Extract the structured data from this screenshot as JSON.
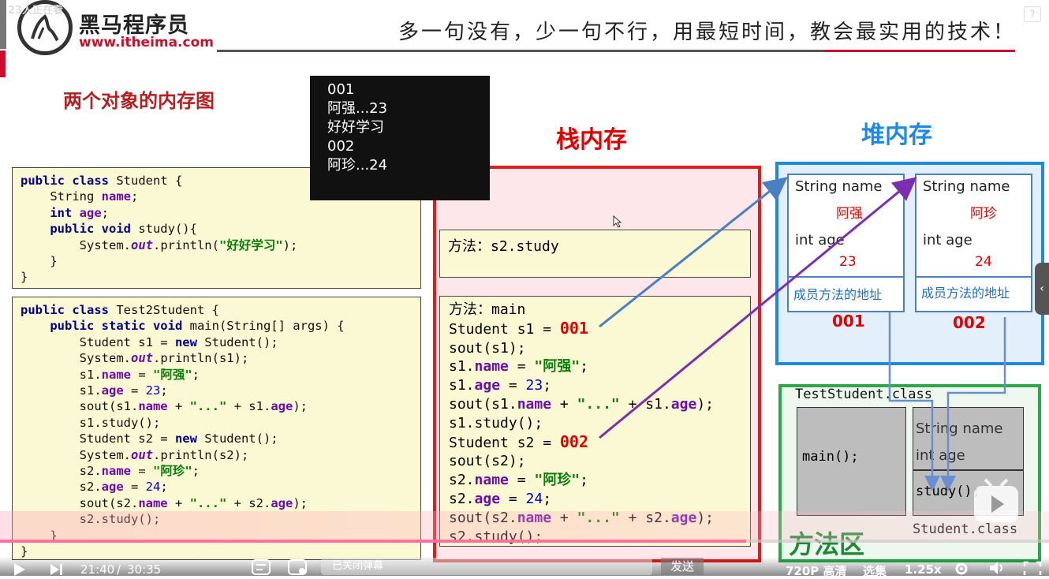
{
  "header": {
    "brand_cn": "黑马程序员",
    "brand_url": "www.itheima.com",
    "slogan": "多一句没有，少一句不行，用最短时间，教会最实用的技术！",
    "overlay_count": "23人正在看",
    "help_label": "?"
  },
  "slide": {
    "title": "两个对象的内存图",
    "stack_title": "栈内存",
    "heap_title": "堆内存",
    "method_area_title": "方法区"
  },
  "console_output": [
    "001",
    "阿强...23",
    "好好学习",
    "002",
    "阿珍...24"
  ],
  "code_student": [
    [
      [
        "kw",
        "public class "
      ],
      [
        "t",
        "Student {"
      ]
    ],
    [
      [
        "t",
        "    String "
      ],
      [
        "fld",
        "name"
      ],
      [
        "t",
        ";"
      ]
    ],
    [
      [
        "t",
        "    "
      ],
      [
        "kw",
        "int "
      ],
      [
        "fld",
        "age"
      ],
      [
        "t",
        ";"
      ]
    ],
    [
      [
        "t",
        "    "
      ],
      [
        "kw",
        "public void "
      ],
      [
        "t",
        "study(){"
      ]
    ],
    [
      [
        "t",
        "        System."
      ],
      [
        "it",
        "out"
      ],
      [
        "t",
        ".println("
      ],
      [
        "str",
        "\"好好学习\""
      ],
      [
        "t",
        ");"
      ]
    ],
    [
      [
        "t",
        "    }"
      ]
    ],
    [
      [
        "t",
        "}"
      ]
    ]
  ],
  "code_test": [
    [
      [
        "kw",
        "public class "
      ],
      [
        "t",
        "Test2Student {"
      ]
    ],
    [
      [
        "t",
        "    "
      ],
      [
        "kw",
        "public static void "
      ],
      [
        "t",
        "main(String[] args) {"
      ]
    ],
    [
      [
        "t",
        "        Student s1 = "
      ],
      [
        "kw",
        "new "
      ],
      [
        "t",
        "Student();"
      ]
    ],
    [
      [
        "t",
        "        System."
      ],
      [
        "it",
        "out"
      ],
      [
        "t",
        ".println(s1);"
      ]
    ],
    [
      [
        "t",
        "        s1."
      ],
      [
        "fld",
        "name"
      ],
      [
        "t",
        " = "
      ],
      [
        "str",
        "\"阿强\""
      ],
      [
        "t",
        ";"
      ]
    ],
    [
      [
        "t",
        "        s1."
      ],
      [
        "fld",
        "age"
      ],
      [
        "t",
        " = "
      ],
      [
        "num",
        "23"
      ],
      [
        "t",
        ";"
      ]
    ],
    [
      [
        "t",
        "        sout(s1."
      ],
      [
        "fld",
        "name"
      ],
      [
        "t",
        " + "
      ],
      [
        "str",
        "\"...\""
      ],
      [
        "t",
        " + s1."
      ],
      [
        "fld",
        "age"
      ],
      [
        "t",
        ");"
      ]
    ],
    [
      [
        "t",
        "        s1.study();"
      ]
    ],
    [
      [
        "t",
        "        Student s2 = "
      ],
      [
        "kw",
        "new "
      ],
      [
        "t",
        "Student();"
      ]
    ],
    [
      [
        "t",
        "        System."
      ],
      [
        "it",
        "out"
      ],
      [
        "t",
        ".println(s2);"
      ]
    ],
    [
      [
        "t",
        "        s2."
      ],
      [
        "fld",
        "name"
      ],
      [
        "t",
        " = "
      ],
      [
        "str",
        "\"阿珍\""
      ],
      [
        "t",
        ";"
      ]
    ],
    [
      [
        "t",
        "        s2."
      ],
      [
        "fld",
        "age"
      ],
      [
        "t",
        " = "
      ],
      [
        "num",
        "24"
      ],
      [
        "t",
        ";"
      ]
    ],
    [
      [
        "t",
        "        sout(s2."
      ],
      [
        "fld",
        "name"
      ],
      [
        "t",
        " + "
      ],
      [
        "str",
        "\"...\""
      ],
      [
        "t",
        " + s2."
      ],
      [
        "fld",
        "age"
      ],
      [
        "t",
        ");"
      ]
    ],
    [
      [
        "t",
        "        s2.study();"
      ]
    ],
    [
      [
        "t",
        "    }"
      ]
    ],
    [
      [
        "t",
        "}"
      ]
    ]
  ],
  "stack": {
    "frame_s2": "方法：s2.study",
    "frame_main": [
      [
        [
          "t",
          "方法：main"
        ]
      ],
      [
        [
          "t",
          "Student s1 = "
        ],
        [
          "addr",
          "001"
        ]
      ],
      [
        [
          "t",
          "sout(s1);"
        ]
      ],
      [
        [
          "t",
          "s1."
        ],
        [
          "fld",
          "name"
        ],
        [
          "t",
          " = "
        ],
        [
          "str",
          "\"阿强\""
        ],
        [
          "t",
          ";"
        ]
      ],
      [
        [
          "t",
          "s1."
        ],
        [
          "fld",
          "age"
        ],
        [
          "t",
          " = "
        ],
        [
          "num",
          "23"
        ],
        [
          "t",
          ";"
        ]
      ],
      [
        [
          "t",
          "sout(s1."
        ],
        [
          "fld",
          "name"
        ],
        [
          "t",
          " + "
        ],
        [
          "str",
          "\"...\""
        ],
        [
          "t",
          " + s1."
        ],
        [
          "fld",
          "age"
        ],
        [
          "t",
          ");"
        ]
      ],
      [
        [
          "t",
          "s1.study();"
        ]
      ],
      [
        [
          "t",
          "Student s2 = "
        ],
        [
          "addr",
          "002"
        ]
      ],
      [
        [
          "t",
          "sout(s2);"
        ]
      ],
      [
        [
          "t",
          "s2."
        ],
        [
          "fld",
          "name"
        ],
        [
          "t",
          " = "
        ],
        [
          "str",
          "\"阿珍\""
        ],
        [
          "t",
          ";"
        ]
      ],
      [
        [
          "t",
          "s2."
        ],
        [
          "fld",
          "age"
        ],
        [
          "t",
          " = "
        ],
        [
          "num",
          "24"
        ],
        [
          "t",
          ";"
        ]
      ],
      [
        [
          "t",
          "sout(s2."
        ],
        [
          "fld",
          "name"
        ],
        [
          "t",
          " + "
        ],
        [
          "str",
          "\"...\""
        ],
        [
          "t",
          " + s2."
        ],
        [
          "fld",
          "age"
        ],
        [
          "t",
          ");"
        ]
      ],
      [
        [
          "t",
          "s2.study();"
        ]
      ]
    ]
  },
  "heap": {
    "objects": [
      {
        "name_label": "String name",
        "name_value": "阿强",
        "age_label": "int age",
        "age_value": "23",
        "member_label": "成员方法的地址",
        "address": "001"
      },
      {
        "name_label": "String name",
        "name_value": "阿珍",
        "age_label": "int age",
        "age_value": "24",
        "member_label": "成员方法的地址",
        "address": "002"
      }
    ]
  },
  "method_area": {
    "test_class": "TestStudent.class",
    "main_method": "main();",
    "student_fields": [
      "String name",
      "int age"
    ],
    "study_method": "study();",
    "student_class": "Student.class"
  },
  "player": {
    "time_current": "21:40",
    "time_total": "30:35",
    "time_sep": "/",
    "danmaku_placeholder": "已关闭弹幕",
    "send_label": "发送",
    "quality_label": "720P 高清",
    "episodes_label": "选集",
    "speed_label": "1.25x",
    "progress": 0.711,
    "accent": "#ff6fa0"
  },
  "colors": {
    "stack_border": "#e21b1b",
    "heap_border": "#1e88e5",
    "method_border": "#2aa84a",
    "ref_arrow_1": "#4a7fc1",
    "ref_arrow_2": "#7b2fb0"
  }
}
